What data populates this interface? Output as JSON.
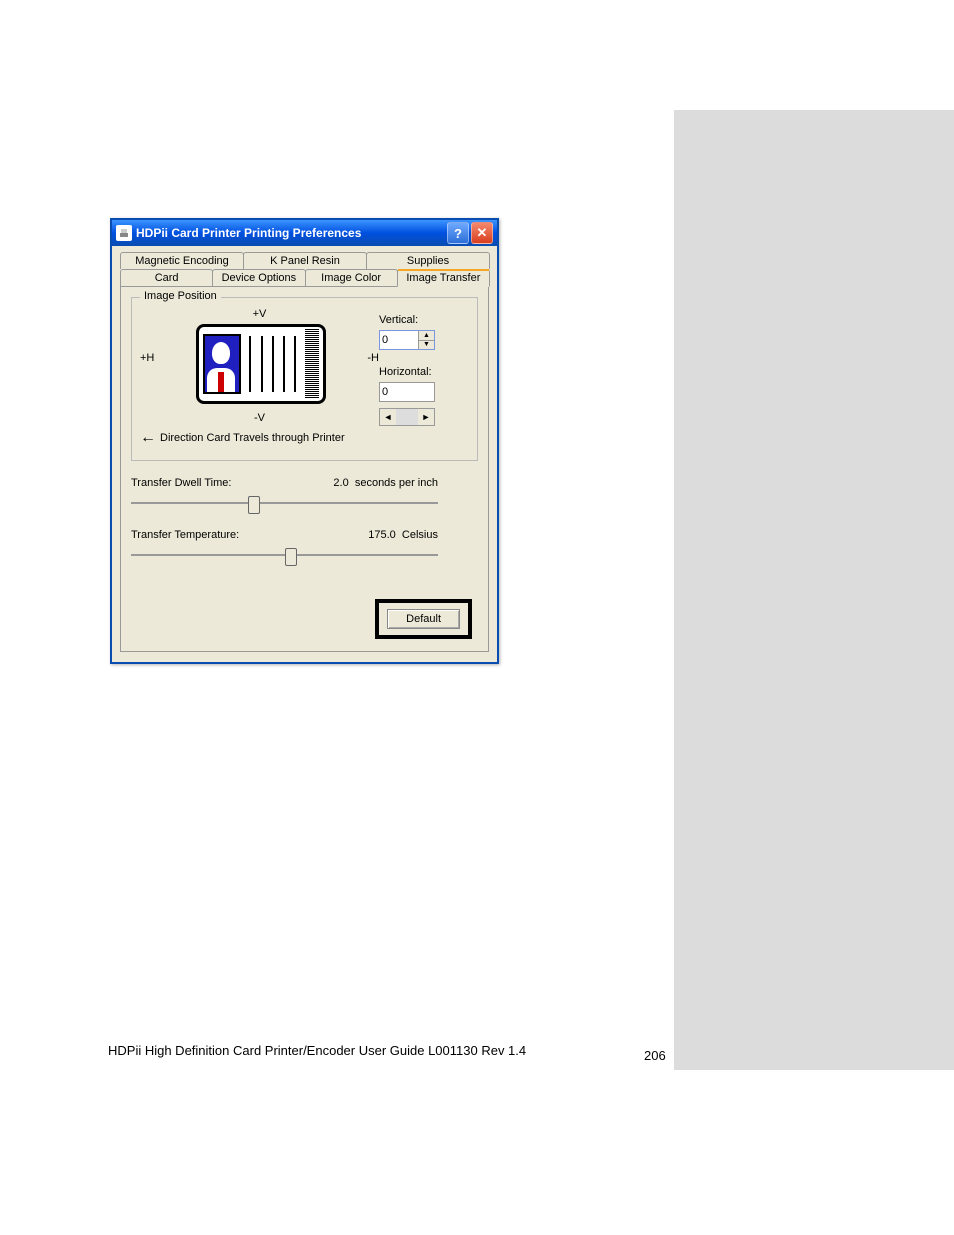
{
  "window": {
    "title": "HDPii Card Printer Printing Preferences"
  },
  "tabs_row1": [
    {
      "label": "Magnetic Encoding"
    },
    {
      "label": "K Panel Resin"
    },
    {
      "label": "Supplies"
    }
  ],
  "tabs_row2": [
    {
      "label": "Card"
    },
    {
      "label": "Device Options"
    },
    {
      "label": "Image Color"
    },
    {
      "label": "Image Transfer"
    }
  ],
  "image_position": {
    "group_title": "Image Position",
    "v_plus": "+V",
    "v_minus": "-V",
    "h_plus_left": "+H",
    "h_minus_right": "-H",
    "direction_text": "Direction Card Travels through Printer",
    "vertical_label": "Vertical:",
    "vertical_value": "0",
    "horizontal_label": "Horizontal:",
    "horizontal_value": "0"
  },
  "dwell": {
    "label": "Transfer Dwell Time:",
    "value": "2.0",
    "unit": "seconds per inch"
  },
  "temperature": {
    "label": "Transfer Temperature:",
    "value": "175.0",
    "unit": "Celsius"
  },
  "default_button": "Default",
  "footer": {
    "left": "HDPii High Definition Card Printer/Encoder User Guide    L001130 Rev 1.4",
    "page": "206"
  }
}
